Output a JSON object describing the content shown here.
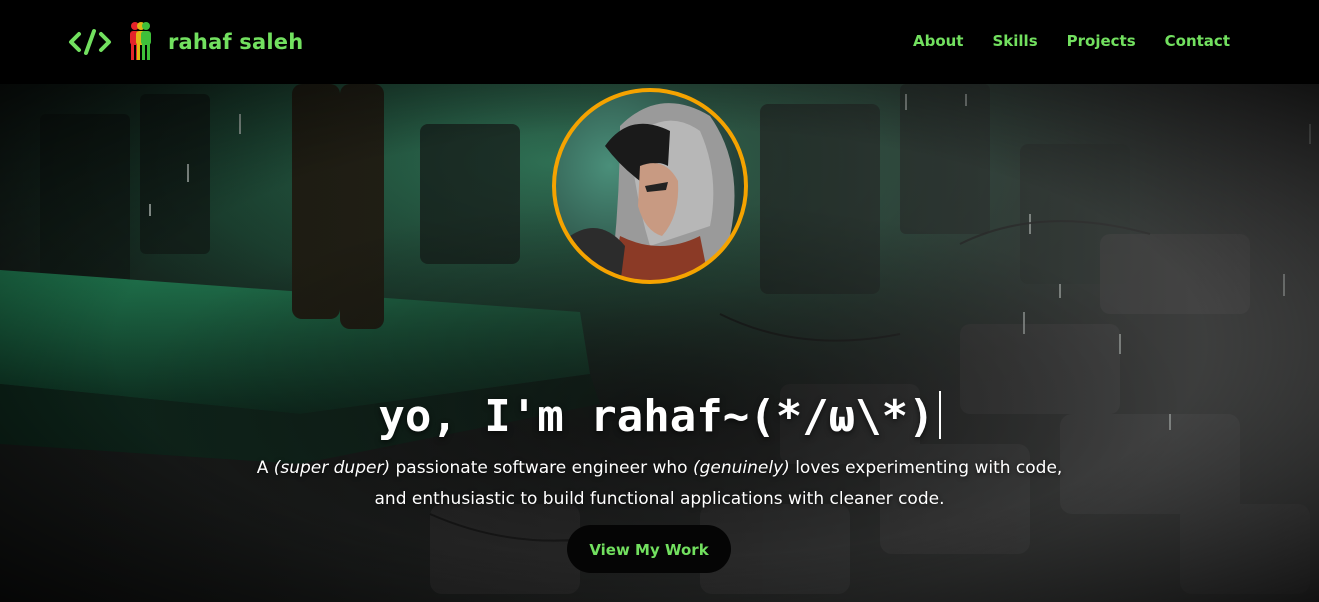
{
  "header": {
    "logo_icon": "code-brackets-icon",
    "logo_figure_icon": "people-silhouette-icon",
    "brand_name": "rahaf saleh",
    "nav": [
      {
        "label": "About"
      },
      {
        "label": "Skills"
      },
      {
        "label": "Projects"
      },
      {
        "label": "Contact"
      }
    ]
  },
  "hero": {
    "avatar_icon": "profile-avatar",
    "headline": "yo, I'm rahaf~(*/ω\\*)",
    "tagline": {
      "line1_prefix": "A ",
      "line1_em1": "(super duper)",
      "line1_mid": " passionate software engineer who ",
      "line1_em2": "(genuinely)",
      "line1_suffix": " loves experimenting with code,",
      "line2": "and enthusiastic to build functional applications with cleaner code."
    },
    "cta_label": "View My Work"
  },
  "colors": {
    "accent": "#72e05f",
    "avatar_ring": "#f5a300",
    "background": "#000000"
  }
}
